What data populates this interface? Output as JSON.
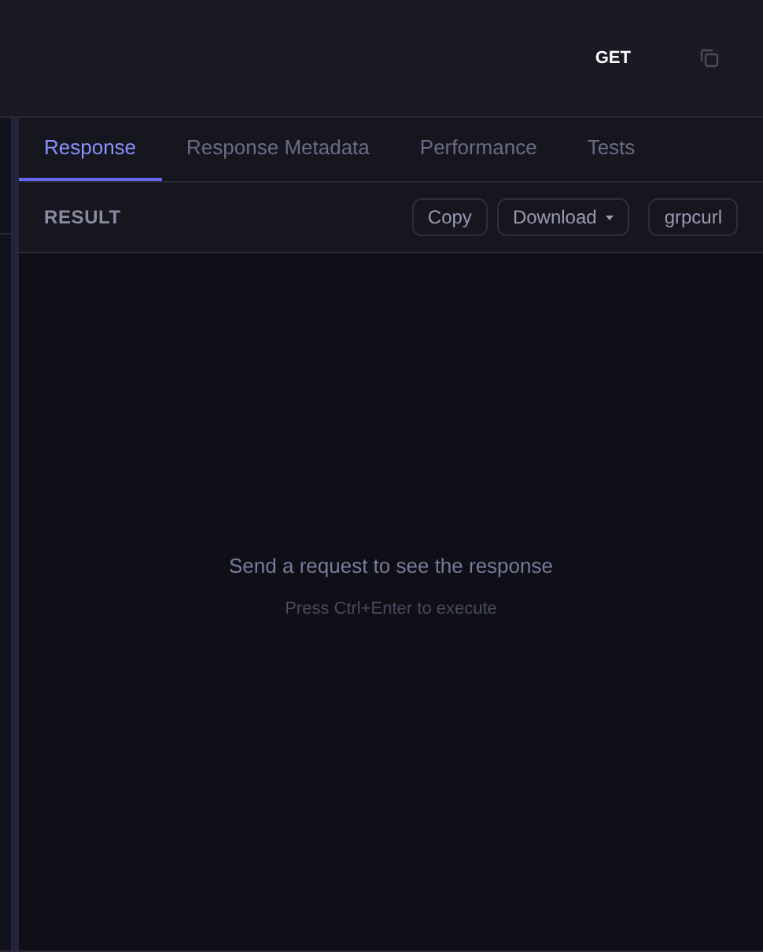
{
  "header": {
    "method": "GET"
  },
  "tabs": [
    {
      "label": "Response",
      "selected": true
    },
    {
      "label": "Response Metadata",
      "selected": false
    },
    {
      "label": "Performance",
      "selected": false
    },
    {
      "label": "Tests",
      "selected": false
    }
  ],
  "result_bar": {
    "title": "RESULT",
    "buttons": [
      {
        "label": "Copy",
        "kind": "plain"
      },
      {
        "label": "Download",
        "kind": "dropdown"
      },
      {
        "label": "grpcurl",
        "kind": "plain"
      }
    ]
  },
  "empty_state": {
    "message": "Send a request to see the response",
    "hint": "Press Ctrl+Enter to execute"
  }
}
